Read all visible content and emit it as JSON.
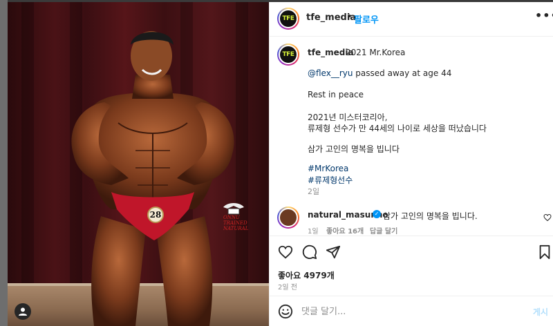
{
  "post": {
    "author": "tfe_media",
    "avatar_text": "TFE",
    "dot": "•",
    "follow_label": "팔로우",
    "more_label": "•••",
    "caption": {
      "title": "2021 Mr.Korea",
      "mention": "@flex__ryu",
      "line1_rest": " passed away at age 44",
      "line2": "Rest in peace",
      "line3": "2021년 미스터코리아,",
      "line4": "류제형 선수가 만 44세의 나이로 세상을 떠났습니다",
      "line5": "삼가 고인의 명복을 빕니다",
      "hashtag1": "#MrKorea",
      "hashtag2": "#류제형선수",
      "time": "2일"
    },
    "comment": {
      "user": "natural_masunho",
      "verified": "✓",
      "text": "삼가 고인의 명복을 빕니다.",
      "time": "1일",
      "likes": "좋아요 16개",
      "reply": "답글 달기"
    },
    "likes": "좋아요 4979개",
    "date": "2일 전",
    "comment_placeholder": "댓글 달기...",
    "post_button": "게시"
  },
  "photo": {
    "bib_number": "28",
    "brand": "ONNU\nTRAINED\nNATURAL",
    "colors": {
      "skin": "#7a3a1c",
      "trunks": "#c0162a",
      "curtain": "#4a1216"
    }
  },
  "icons": [
    "heart-icon",
    "comment-icon",
    "share-icon",
    "bookmark-icon",
    "emoji-icon",
    "user-tag-icon",
    "more-icon",
    "verified-icon"
  ]
}
